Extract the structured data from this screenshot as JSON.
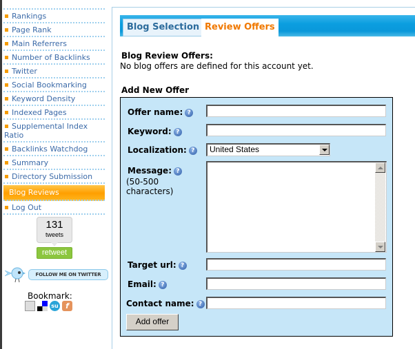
{
  "sidebar": {
    "items": [
      {
        "label": "Rankings",
        "active": false
      },
      {
        "label": "Page Rank",
        "active": false
      },
      {
        "label": "Main Referrers",
        "active": false
      },
      {
        "label": "Number of Backlinks",
        "active": false
      },
      {
        "label": "Twitter",
        "active": false
      },
      {
        "label": "Social Bookmarking",
        "active": false
      },
      {
        "label": "Keyword Density",
        "active": false
      },
      {
        "label": "Indexed Pages",
        "active": false
      },
      {
        "label": "Supplemental Index Ratio",
        "active": false
      },
      {
        "label": "Backlinks Watchdog",
        "active": false
      },
      {
        "label": "Summary",
        "active": false
      },
      {
        "label": "Directory Submission",
        "active": false
      },
      {
        "label": "Blog Reviews",
        "active": true
      },
      {
        "label": "Log Out",
        "active": false
      }
    ],
    "tweet_count": "131",
    "tweet_label": "tweets",
    "retweet_label": "retweet",
    "follow_label": "FOLLOW ME ON TWITTER",
    "bookmark_label": "Bookmark:",
    "bookmark_icons": [
      "myweb-icon",
      "delicious-icon",
      "stumbleupon-icon",
      "furl-icon"
    ]
  },
  "tabs": [
    {
      "label": "Blog Selection",
      "active": false
    },
    {
      "label": "Review Offers",
      "active": true
    }
  ],
  "offers": {
    "title": "Blog Review Offers:",
    "empty_text": "No blog offers are defined for this account yet."
  },
  "form": {
    "title": "Add New Offer",
    "fields": {
      "offer_name": {
        "label": "Offer name:",
        "value": ""
      },
      "keyword": {
        "label": "Keyword:",
        "value": ""
      },
      "localization": {
        "label": "Localization:",
        "value": "United States"
      },
      "message": {
        "label": "Message:",
        "hint": "(50-500",
        "hint2": "characters)",
        "value": ""
      },
      "target_url": {
        "label": "Target url:",
        "value": ""
      },
      "email": {
        "label": "Email:",
        "value": ""
      },
      "contact_name": {
        "label": "Contact name:",
        "value": ""
      }
    },
    "help_glyph": "?",
    "submit_label": "Add offer"
  },
  "colors": {
    "accent_orange": "#f07800",
    "nav_link": "#3b6aa8",
    "tab_bar_blue": "#0b9ee0",
    "form_bg": "#c6e6f8"
  }
}
